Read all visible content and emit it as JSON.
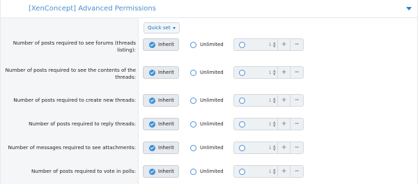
{
  "header": {
    "title": "[XenConcept] Advanced Permissions",
    "toggle_icon": "chevron-down-icon"
  },
  "quick_set": {
    "label": "Quick set"
  },
  "options": {
    "inherit_label": "Inherit",
    "unlimited_label": "Unlimited",
    "plus_symbol": "+",
    "minus_symbol": "−"
  },
  "permissions": [
    {
      "label": "Number of posts required to see forums (threads listing):",
      "selected": "inherit",
      "value": "1"
    },
    {
      "label": "Number of posts required to see the contents of the threads:",
      "selected": "inherit",
      "value": "1"
    },
    {
      "label": "Number of posts required to create new threads:",
      "selected": "inherit",
      "value": "1"
    },
    {
      "label": "Number of posts required to reply threads:",
      "selected": "inherit",
      "value": "1"
    },
    {
      "label": "Number of messages required to see attachments:",
      "selected": "inherit",
      "value": "1"
    },
    {
      "label": "Number of posts required to vote in polls:",
      "selected": "inherit",
      "value": "1"
    }
  ],
  "colors": {
    "accent": "#3b8fdc",
    "header_text": "#4a8fd1",
    "label_bg": "#f5f6f8"
  }
}
